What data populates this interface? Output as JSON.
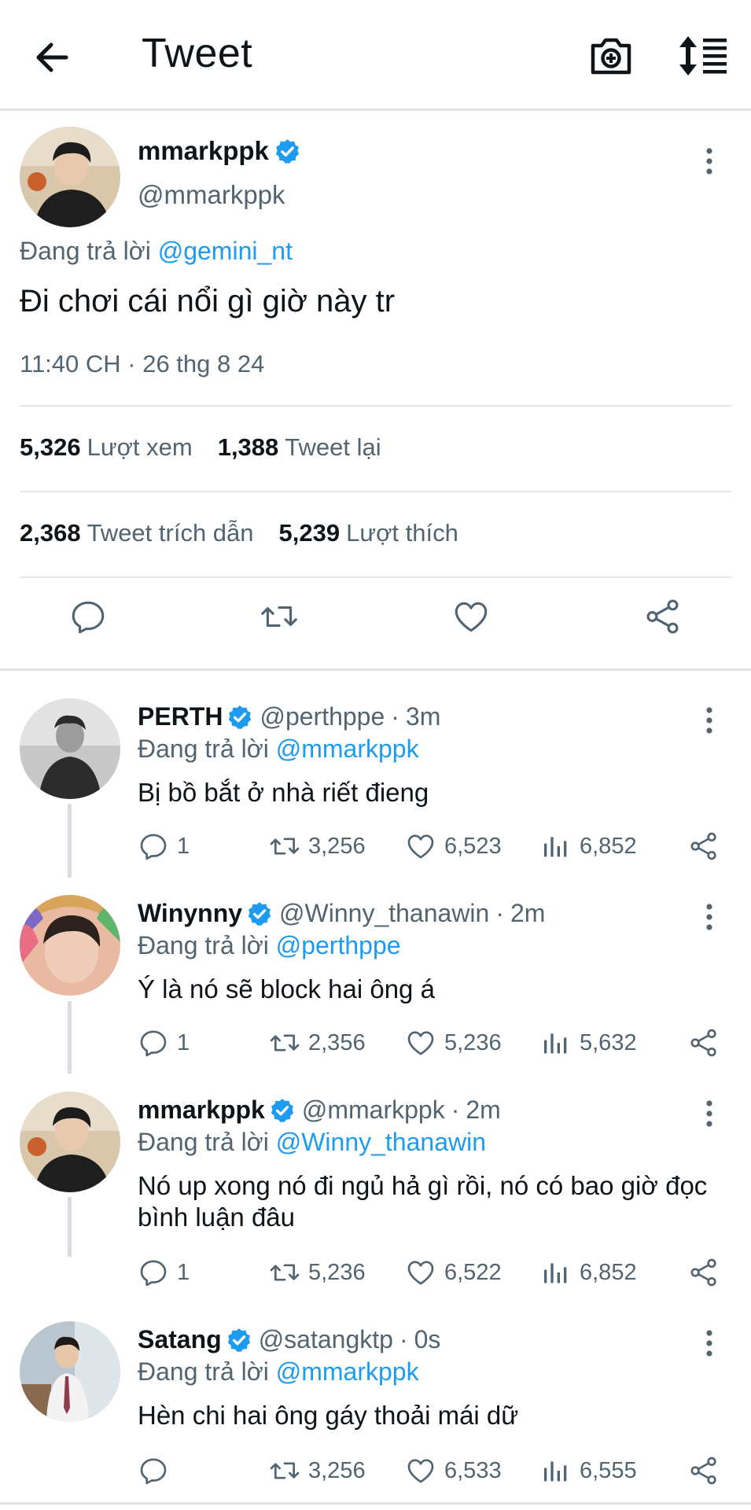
{
  "header": {
    "title": "Tweet",
    "back_icon": "arrow-left-icon",
    "camera_icon": "camera-plus-icon",
    "sort_icon": "sort-lines-icon"
  },
  "main_tweet": {
    "name": "mmarkppk",
    "verified": true,
    "handle": "@mmarkppk",
    "reply_prefix": "Đang trả lời",
    "reply_mention": "@gemini_nt",
    "text": "Đi chơi cái nổi gì giờ này tr",
    "timestamp": "11:40 CH · 26 thg 8 24",
    "stats": {
      "views_count": "5,326",
      "views_label": "Lượt xem",
      "retweets_count": "1,388",
      "retweets_label": "Tweet lại",
      "quotes_count": "2,368",
      "quotes_label": "Tweet trích dẫn",
      "likes_count": "5,239",
      "likes_label": "Lượt thích"
    },
    "actions": [
      "reply-icon",
      "retweet-icon",
      "like-icon",
      "share-icon"
    ]
  },
  "replies": [
    {
      "name": "PERTH",
      "verified": true,
      "handle": "@perthppe",
      "separator": "·",
      "time": "3m",
      "reply_prefix": "Đang trả lời",
      "reply_mention": "@mmarkppk",
      "text": "Bị bồ bắt ở nhà riết đieng",
      "replies": "1",
      "retweets": "3,256",
      "likes": "6,523",
      "views": "6,852"
    },
    {
      "name": "Winynny",
      "verified": true,
      "handle": "@Winny_thanawin",
      "separator": "·",
      "time": "2m",
      "reply_prefix": "Đang trả lời",
      "reply_mention": "@perthppe",
      "text": "Ý là nó sẽ block hai ông á",
      "replies": "1",
      "retweets": "2,356",
      "likes": "5,236",
      "views": "5,632"
    },
    {
      "name": "mmarkppk",
      "verified": true,
      "handle": "@mmarkppk",
      "separator": "·",
      "time": "2m",
      "reply_prefix": "Đang trả lời",
      "reply_mention": "@Winny_thanawin",
      "text": "Nó up xong nó đi ngủ hả gì rồi, nó có bao giờ đọc bình luận đâu",
      "replies": "1",
      "retweets": "5,236",
      "likes": "6,522",
      "views": "6,852"
    },
    {
      "name": "Satang",
      "verified": true,
      "handle": "@satangktp",
      "separator": "·",
      "time": "0s",
      "reply_prefix": "Đang trả lời",
      "reply_mention": "@mmarkppk",
      "text": "Hèn chi hai ông gáy thoải mái dữ",
      "replies": "",
      "retweets": "3,256",
      "likes": "6,533",
      "views": "6,555"
    }
  ],
  "colors": {
    "accent": "#1d9bf0",
    "text": "#0f1419",
    "secondary": "#536471",
    "divider": "#e3e3e3"
  }
}
